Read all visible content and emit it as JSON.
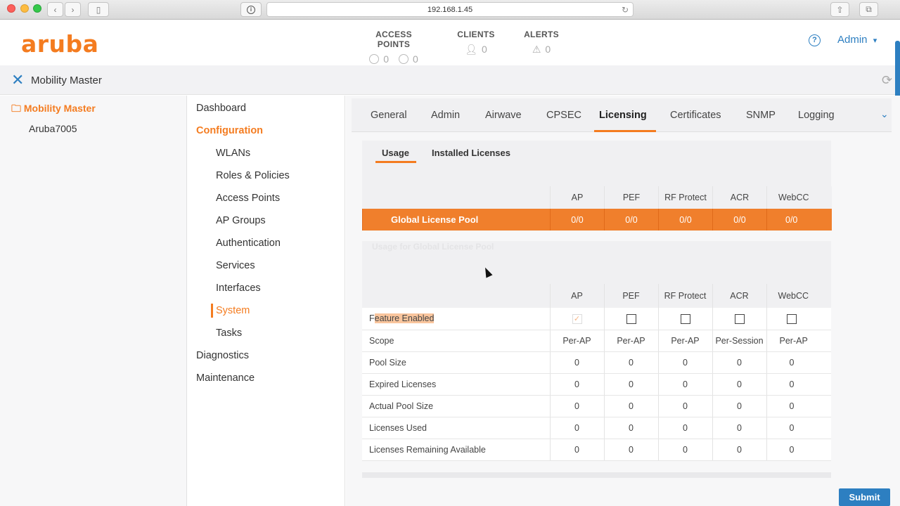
{
  "browser": {
    "url": "192.168.1.45",
    "reload_icon": "reload-icon"
  },
  "header": {
    "logo": "aruba",
    "stats": [
      {
        "title": "ACCESS POINTS",
        "values": [
          "0",
          "0"
        ]
      },
      {
        "title": "CLIENTS",
        "values": [
          "0"
        ]
      },
      {
        "title": "ALERTS",
        "values": [
          "0"
        ]
      }
    ],
    "help": "?",
    "user": "Admin"
  },
  "mobility_bar": {
    "title": "Mobility Master"
  },
  "tree": {
    "root": "Mobility Master",
    "child": "Aruba7005"
  },
  "nav": {
    "items": [
      {
        "label": "Dashboard"
      },
      {
        "label": "Configuration"
      },
      {
        "label": "WLANs"
      },
      {
        "label": "Roles & Policies"
      },
      {
        "label": "Access Points"
      },
      {
        "label": "AP Groups"
      },
      {
        "label": "Authentication"
      },
      {
        "label": "Services"
      },
      {
        "label": "Interfaces"
      },
      {
        "label": "System"
      },
      {
        "label": "Tasks"
      },
      {
        "label": "Diagnostics"
      },
      {
        "label": "Maintenance"
      }
    ]
  },
  "tabs": [
    "General",
    "Admin",
    "Airwave",
    "CPSEC",
    "Licensing",
    "Certificates",
    "SNMP",
    "Logging"
  ],
  "subtabs": [
    "Usage",
    "Installed Licenses"
  ],
  "license_columns": [
    "AP",
    "PEF",
    "RF Protect",
    "ACR",
    "WebCC"
  ],
  "global_pool": {
    "label": "Global License Pool",
    "values": [
      "0/0",
      "0/0",
      "0/0",
      "0/0",
      "0/0"
    ]
  },
  "usage_section_title": "Usage for Global License Pool",
  "usage_rows": [
    {
      "label": "Feature Enabled",
      "values": [
        "checked",
        "unchecked",
        "unchecked",
        "unchecked",
        "unchecked"
      ]
    },
    {
      "label": "Scope",
      "values": [
        "Per-AP",
        "Per-AP",
        "Per-AP",
        "Per-Session",
        "Per-AP"
      ]
    },
    {
      "label": "Pool Size",
      "values": [
        "0",
        "0",
        "0",
        "0",
        "0"
      ]
    },
    {
      "label": "Expired Licenses",
      "values": [
        "0",
        "0",
        "0",
        "0",
        "0"
      ]
    },
    {
      "label": "Actual Pool Size",
      "values": [
        "0",
        "0",
        "0",
        "0",
        "0"
      ]
    },
    {
      "label": "Licenses Used",
      "values": [
        "0",
        "0",
        "0",
        "0",
        "0"
      ]
    },
    {
      "label": "Licenses Remaining Available",
      "values": [
        "0",
        "0",
        "0",
        "0",
        "0"
      ]
    }
  ],
  "submit_label": "Submit",
  "colors": {
    "brand": "#f47c20",
    "link": "#2d7fc1"
  }
}
